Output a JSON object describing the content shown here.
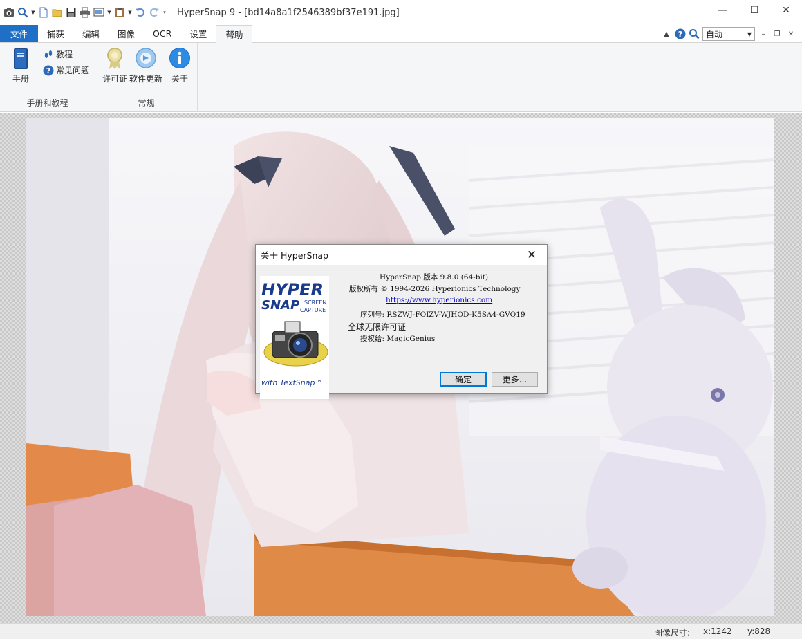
{
  "window": {
    "title": "HyperSnap 9 - [bd14a8a1f2546389bf37e191.jpg]",
    "controls": {
      "minimize": "—",
      "maximize": "☐",
      "close": "✕"
    }
  },
  "quick_access": [
    "capture-icon",
    "zoom-icon",
    "new-icon",
    "open-icon",
    "save-icon",
    "print-icon",
    "copy-icon",
    "paste-icon",
    "undo-icon",
    "redo-icon"
  ],
  "tabs": {
    "file": "文件",
    "items": [
      "捕获",
      "编辑",
      "图像",
      "OCR",
      "设置",
      "帮助"
    ],
    "active": "帮助"
  },
  "toolbar_right": {
    "zoom_value": "自动"
  },
  "ribbon": {
    "group1": {
      "label": "手册和教程",
      "manual": "手册",
      "tutorial": "教程",
      "faq": "常见问题"
    },
    "group2": {
      "label": "常规",
      "license": "许可证",
      "update": "软件更新",
      "about": "关于"
    }
  },
  "dialog": {
    "title": "关于 HyperSnap",
    "logo": {
      "line1": "HYPER",
      "line2": "SNAP",
      "line3": "SCREEN",
      "line4": "CAPTURE",
      "tagline": "with TextSnap™"
    },
    "version": "HyperSnap 版本 9.8.0 (64-bit)",
    "copyright": "版权所有 © 1994-2026 Hyperionics Technology",
    "url": "https://www.hyperionics.com",
    "serial": "序列号: RSZWJ-FOIZV-WJHOD-K5SA4-GVQ19",
    "license_type": "全球无限许可证",
    "licensed_to": "授权给: MagicGenius",
    "ok_button": "确定",
    "more_button": "更多..."
  },
  "statusbar": {
    "image_size_label": "图像尺寸:",
    "x": "x:1242",
    "y": "y:828"
  },
  "colors": {
    "file_tab": "#1e6fc6",
    "ribbon_bg": "#f5f6f7",
    "link": "#0000cc",
    "logo_blue": "#1a3a8c"
  }
}
